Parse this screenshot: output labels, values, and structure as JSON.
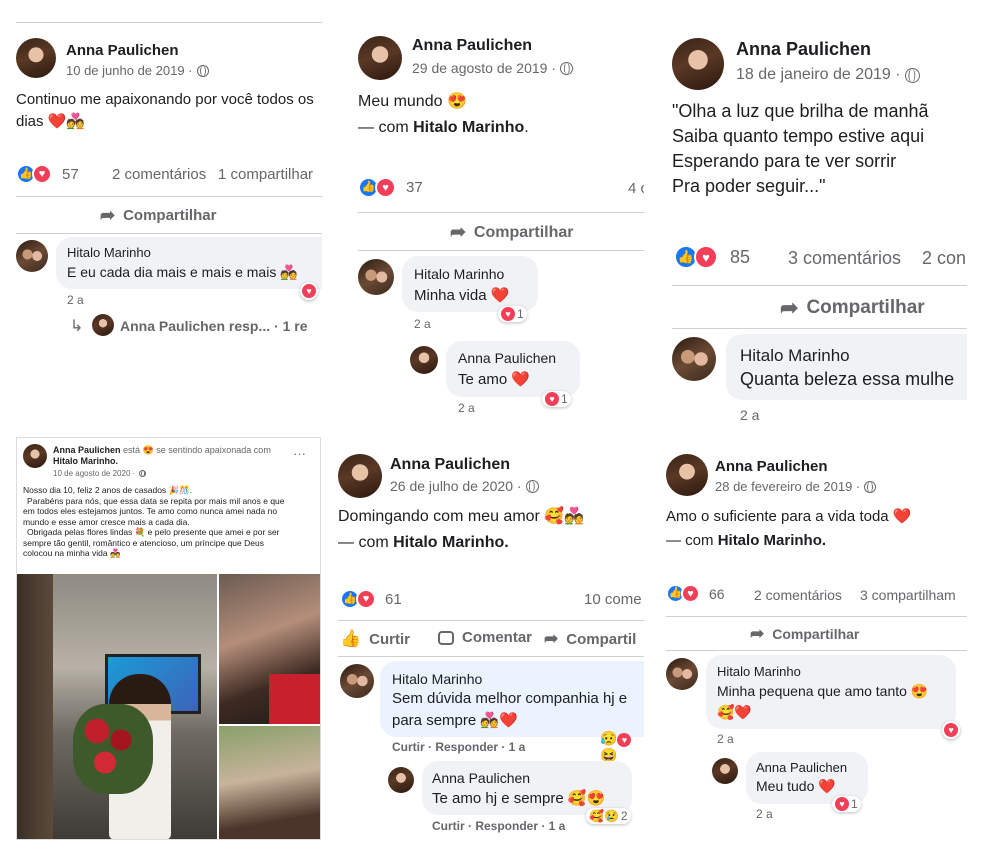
{
  "p1": {
    "name": "Anna Paulichen",
    "date": "10 de junho de 2019 · ",
    "text": "Continuo me apaixonando por você todos os",
    "text2": "dias ❤️💑",
    "count": "57",
    "comments": "2 comentários",
    "shares": "1 compartilhar",
    "share": "Compartilhar",
    "c_name": "Hitalo Marinho",
    "c_text": "E eu cada dia mais e mais e mais 💑",
    "c_time": "2 a",
    "reply_name": "Anna Paulichen resp...",
    "reply_count": "· 1 re"
  },
  "p2": {
    "name": "Anna Paulichen",
    "date": "29 de agosto de 2019 · ",
    "text": "Meu mundo 😍",
    "with": "— com ",
    "with_name": "Hitalo Marinho",
    "count": "37",
    "comments": "4 c",
    "share": "Compartilhar",
    "c1_name": "Hitalo Marinho",
    "c1_text": "Minha vida ❤️",
    "c1_time": "2 a",
    "c1_r": "1",
    "c2_name": "Anna Paulichen",
    "c2_text": "Te amo ❤️",
    "c2_time": "2 a",
    "c2_r": "1"
  },
  "p3": {
    "name": "Anna Paulichen",
    "date": "18 de janeiro de 2019 · ",
    "l1": "\"Olha a luz que brilha de manhã",
    "l2": "Saiba quanto tempo estive aqui",
    "l3": "Esperando para te ver sorrir",
    "l4": "Pra poder seguir...\"",
    "count": "85",
    "comments": "3 comentários",
    "shares": "2 con",
    "share": "Compartilhar",
    "c_name": "Hitalo Marinho",
    "c_text": "Quanta beleza essa mulhe",
    "c_time": "2 a"
  },
  "p4": {
    "name": "Anna Paulichen",
    "feeling": " está 😍 se sentindo apaixonada com",
    "with_name": "Hitalo Marinho.",
    "date": "10 de agosto de 2020 · ",
    "lines": [
      "Nosso dia 10, feliz 2 anos de casados 🎉🎊.",
      "Parabéns para nós, que essa data se repita por mais mil anos e que",
      "em todos eles estejamos juntos. Te amo como nunca amei nada no",
      "mundo e esse amor cresce mais a cada dia.",
      "Obrigada  pelas flores lindas 💐 e pelo presente que amei e por ser",
      "sempre tão gentil, romântico e atencioso, um príncipe que Deus",
      "colocou na minha vida 💑"
    ],
    "dots": "···"
  },
  "p5": {
    "name": "Anna Paulichen",
    "date": "26 de julho de 2020 · ",
    "text": "Domingando com meu amor 🥰💑",
    "with": "— com ",
    "with_name": "Hitalo Marinho.",
    "count": "61",
    "comments": "10 come",
    "like": "Curtir",
    "comment": "Comentar",
    "share": "Compartil",
    "c1_name": "Hitalo Marinho",
    "c1_text": "Sem dúvida melhor companhia hj e",
    "c1_text2": "para sempre 💑❤️",
    "c1_actions": "Curtir · Responder · 1 a",
    "c2_name": "Anna Paulichen",
    "c2_text": "Te amo hj e sempre 🥰😍",
    "c2_actions": "Curtir · Responder · 1 a",
    "c2_r": "2"
  },
  "p6": {
    "name": "Anna Paulichen",
    "date": "28 de fevereiro de 2019 · ",
    "text": "Amo o suficiente para a vida toda ❤️",
    "with": "— com ",
    "with_name": "Hitalo Marinho.",
    "count": "66",
    "comments": "2 comentários",
    "shares": "3 compartilham",
    "share": "Compartilhar",
    "c1_name": "Hitalo Marinho",
    "c1_text": "Minha pequena que amo tanto 😍",
    "c1_text2": "🥰❤️",
    "c1_time": "2 a",
    "c2_name": "Anna Paulichen",
    "c2_text": "Meu tudo ❤️",
    "c2_time": "2 a",
    "c2_r": "1"
  },
  "colors": {
    "blue": "#1877f2",
    "red": "#f33e58",
    "gray": "#65676b",
    "bubble": "#f0f2f5"
  }
}
